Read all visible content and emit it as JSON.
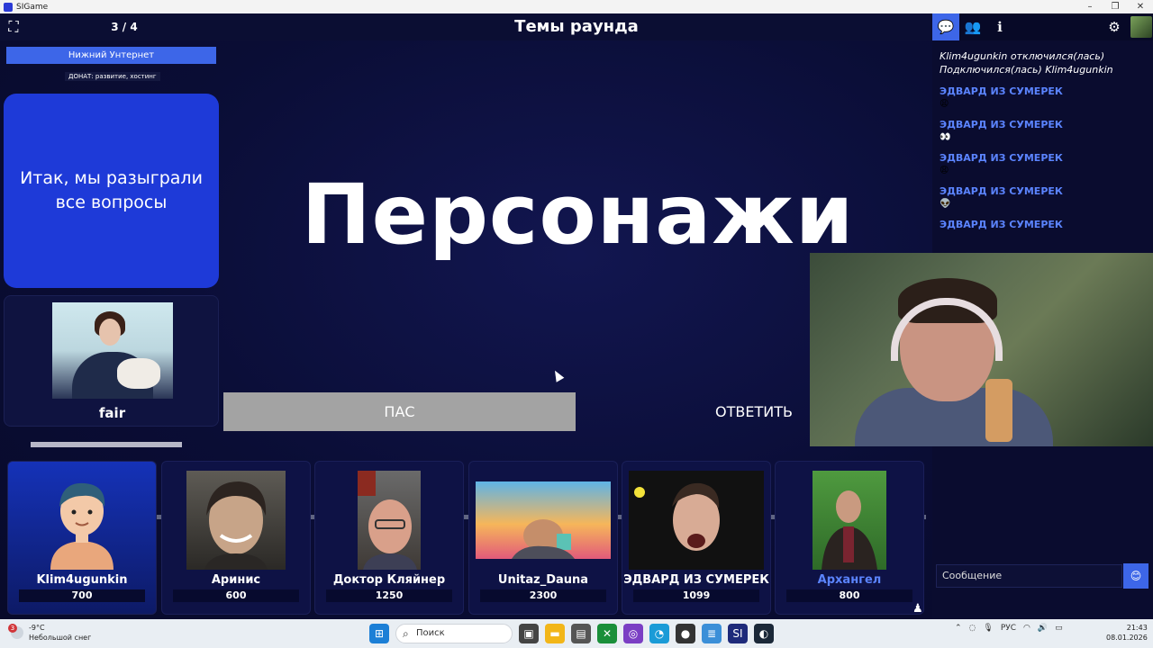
{
  "window": {
    "title": "SIGame",
    "controls": [
      "–",
      "❐",
      "✕"
    ]
  },
  "topbar": {
    "counter": "3 / 4",
    "round_title": "Темы раунда"
  },
  "left": {
    "theme": "Нижний Унтернет",
    "donate": "ДОНАТ: развитие, хостинг",
    "question_text": "Итак, мы разыграли все вопросы",
    "host_name": "fair"
  },
  "main": {
    "word": "Персонажи",
    "pass_label": "ПАС",
    "answer_label": "ОТВЕТИТЬ"
  },
  "chat": {
    "system_lines": [
      "Klim4ugunkin отключился(лась)",
      "Подключился(лась) Klim4ugunkin"
    ],
    "messages": [
      {
        "author": "ЭДВАРД ИЗ СУМЕРЕК",
        "text": "😩"
      },
      {
        "author": "ЭДВАРД ИЗ СУМЕРЕК",
        "text": "👀"
      },
      {
        "author": "ЭДВАРД ИЗ СУМЕРЕК",
        "text": "😩"
      },
      {
        "author": "ЭДВАРД ИЗ СУМЕРЕК",
        "text": "👽"
      },
      {
        "author": "ЭДВАРД ИЗ СУМЕРЕК",
        "text": ""
      }
    ],
    "input_placeholder": "Сообщение",
    "emoji_icon": "😊"
  },
  "players": [
    {
      "name": "Klim4ugunkin",
      "score": "700",
      "active": true,
      "avatar": "cartoon-avatar"
    },
    {
      "name": "Аринис",
      "score": "600",
      "active": false,
      "avatar": "photo"
    },
    {
      "name": "Доктор Кляйнер",
      "score": "1250",
      "active": false,
      "avatar": "photo"
    },
    {
      "name": "Unitaz_Dauna",
      "score": "2300",
      "active": false,
      "avatar": "photo"
    },
    {
      "name": "ЭДВАРД ИЗ СУМЕРЕК",
      "score": "1099",
      "active": false,
      "avatar": "photo"
    },
    {
      "name": "Архангел",
      "score": "800",
      "active": false,
      "highlight": true,
      "avatar": "photo"
    }
  ],
  "taskbar": {
    "weather_temp": "-9°C",
    "weather_desc": "Небольшой снег",
    "weather_badge": "3",
    "search_label": "Поиск",
    "lang": "РУС",
    "time": "21:43",
    "date": "08.01.2026"
  },
  "colors": {
    "accent": "#3d66e8",
    "bg": "#0b0f3a",
    "card": "#1e3ad8",
    "name_highlight": "#5b84ff"
  }
}
